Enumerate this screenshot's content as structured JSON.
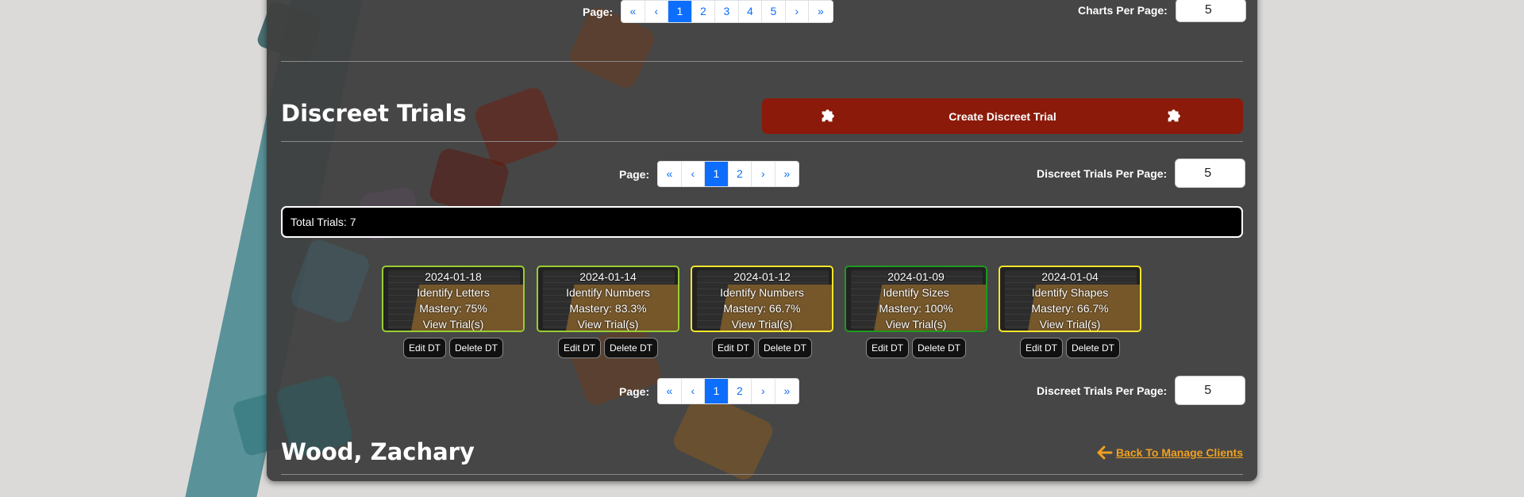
{
  "top_pager": {
    "label": "Page:",
    "pages": [
      "«",
      "‹",
      "1",
      "2",
      "3",
      "4",
      "5",
      "›",
      "»"
    ],
    "active": "1",
    "per_page_label": "Charts Per Page:",
    "per_page_value": "5"
  },
  "section": {
    "title": "Discreet Trials",
    "create_label": "Create Discreet Trial"
  },
  "dt_pager": {
    "label": "Page:",
    "pages": [
      "«",
      "‹",
      "1",
      "2",
      "›",
      "»"
    ],
    "active": "1",
    "per_page_label": "Discreet Trials Per Page:",
    "per_page_value": "5"
  },
  "total": "Total Trials: 7",
  "trials": [
    {
      "date": "2024-01-18",
      "name": "Identify Letters",
      "mastery": "Mastery: 75%",
      "view": "View Trial(s)",
      "border": "#9acd32",
      "edit": "Edit DT",
      "delete": "Delete DT"
    },
    {
      "date": "2024-01-14",
      "name": "Identify Numbers",
      "mastery": "Mastery: 83.3%",
      "view": "View Trial(s)",
      "border": "#9acd32",
      "edit": "Edit DT",
      "delete": "Delete DT"
    },
    {
      "date": "2024-01-12",
      "name": "Identify Numbers",
      "mastery": "Mastery: 66.7%",
      "view": "View Trial(s)",
      "border": "#f5e62a",
      "edit": "Edit DT",
      "delete": "Delete DT"
    },
    {
      "date": "2024-01-09",
      "name": "Identify Sizes",
      "mastery": "Mastery: 100%",
      "view": "View Trial(s)",
      "border": "#1e9a1e",
      "edit": "Edit DT",
      "delete": "Delete DT"
    },
    {
      "date": "2024-01-04",
      "name": "Identify Shapes",
      "mastery": "Mastery: 66.7%",
      "view": "View Trial(s)",
      "border": "#f5e62a",
      "edit": "Edit DT",
      "delete": "Delete DT"
    }
  ],
  "client": {
    "name": "Wood, Zachary",
    "back_label": "Back To Manage Clients"
  },
  "colors": {
    "accent": "#0d6efd",
    "create_button": "#8b1a0a",
    "back_link": "#f0a020"
  }
}
